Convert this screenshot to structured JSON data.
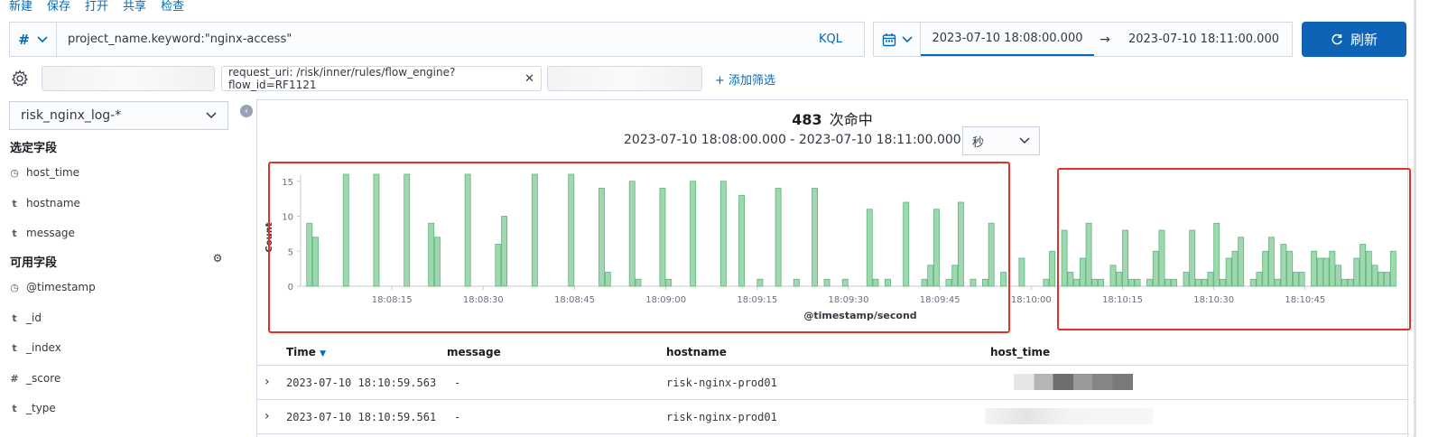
{
  "menu": {
    "new": "新建",
    "save": "保存",
    "open": "打开",
    "share": "共享",
    "inspect": "检查"
  },
  "query": {
    "type_symbol": "#",
    "text": "project_name.keyword:\"nginx-access\"",
    "language": "KQL"
  },
  "time": {
    "start": "2023-07-10 18:08:00.000",
    "arrow": "→",
    "end": "2023-07-10 18:11:00.000"
  },
  "refresh_label": "刷新",
  "filters": {
    "pill": "request_uri: /risk/inner/rules/flow_engine?flow_id=RF1121",
    "add": "+ 添加筛选"
  },
  "sidebar": {
    "index_pattern": "risk_nginx_log-*",
    "selected_title": "选定字段",
    "selected": [
      {
        "type": "clock",
        "name": "host_time"
      },
      {
        "type": "t",
        "name": "hostname"
      },
      {
        "type": "t",
        "name": "message"
      }
    ],
    "available_title": "可用字段",
    "available": [
      {
        "type": "clock",
        "name": "@timestamp"
      },
      {
        "type": "t",
        "name": "_id"
      },
      {
        "type": "t",
        "name": "_index"
      },
      {
        "type": "#",
        "name": "_score"
      },
      {
        "type": "t",
        "name": "_type"
      }
    ]
  },
  "hits": {
    "count": "483",
    "label": "次命中"
  },
  "range_text": "2023-07-10 18:08:00.000 - 2023-07-10 18:11:00.000 —",
  "interval": "秒",
  "chart_data": {
    "type": "bar",
    "xlabel": "@timestamp/second",
    "ylabel": "Count",
    "ylim": [
      0,
      16
    ],
    "yticks": [
      0,
      5,
      10,
      15
    ],
    "xticks": [
      "18:08:15",
      "18:08:30",
      "18:08:45",
      "18:09:00",
      "18:09:15",
      "18:09:30",
      "18:09:45",
      "18:10:00",
      "18:10:15",
      "18:10:30",
      "18:10:45"
    ],
    "xtick_seconds": [
      15,
      30,
      45,
      60,
      75,
      90,
      105,
      120,
      135,
      150,
      165
    ],
    "bar_color": "#9fd8b0",
    "bar_stroke": "#5fb679",
    "seconds": [
      1,
      2,
      7,
      12,
      17,
      21,
      22,
      27,
      32,
      33,
      38,
      44,
      49,
      50,
      54,
      55,
      59,
      60,
      64,
      69,
      72,
      75,
      78,
      81,
      84,
      86,
      89,
      93,
      94,
      96,
      99,
      102,
      103,
      104,
      106,
      107,
      108,
      110,
      112,
      113,
      115,
      118,
      122,
      123,
      125,
      126,
      127,
      128,
      129,
      130,
      131,
      133,
      134,
      135,
      136,
      137,
      139,
      140,
      141,
      142,
      143,
      145,
      146,
      147,
      148,
      149,
      150,
      151,
      152,
      153,
      154,
      156,
      157,
      158,
      159,
      160,
      161,
      162,
      163,
      164,
      166,
      167,
      168,
      169,
      170,
      171,
      172,
      173,
      174,
      175,
      176,
      177,
      178,
      179
    ],
    "values": [
      9,
      7,
      16,
      16,
      16,
      9,
      7,
      16,
      6,
      10,
      16,
      16,
      14,
      2,
      15,
      1,
      14,
      1,
      15,
      15,
      13,
      1,
      14,
      1,
      14,
      1,
      1,
      11,
      1,
      1,
      12,
      1,
      3,
      11,
      1,
      3,
      12,
      1,
      1,
      9,
      2,
      4,
      1,
      5,
      8,
      2,
      1,
      4,
      9,
      1,
      1,
      3,
      2,
      8,
      1,
      1,
      1,
      5,
      8,
      1,
      1,
      2,
      8,
      1,
      1,
      2,
      9,
      1,
      4,
      5,
      7,
      1,
      2,
      5,
      7,
      1,
      6,
      5,
      2,
      2,
      5,
      4,
      4,
      5,
      3,
      1,
      1,
      4,
      6,
      5,
      3,
      2,
      2,
      5
    ],
    "bar_width_seconds": 0.9
  },
  "table": {
    "columns": [
      "Time",
      "message",
      "hostname",
      "host_time"
    ],
    "rows": [
      {
        "time": "2023-07-10 18:10:59.563",
        "message": "-",
        "hostname": "risk-nginx-prod01"
      },
      {
        "time": "2023-07-10 18:10:59.561",
        "message": "-",
        "hostname": "risk-nginx-prod01"
      }
    ]
  }
}
